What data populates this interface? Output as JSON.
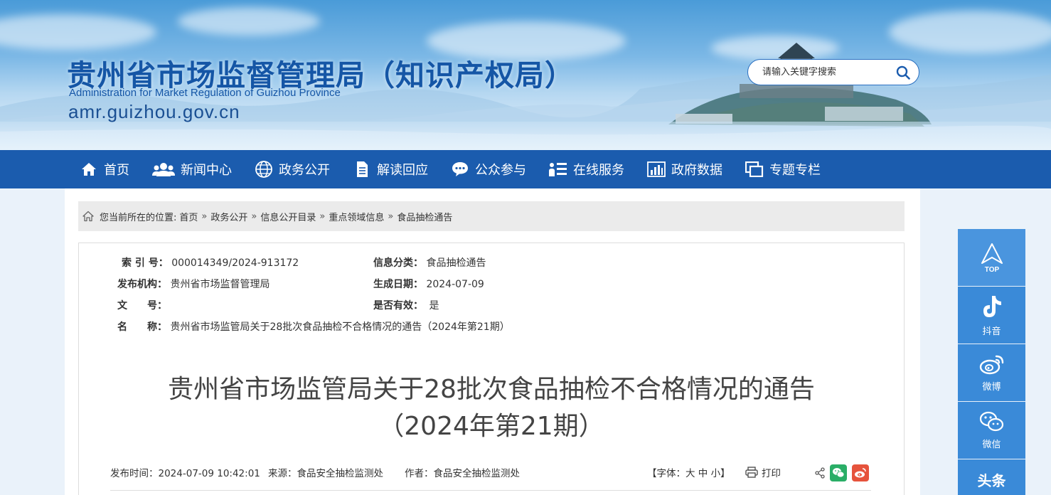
{
  "header": {
    "title": "贵州省市场监督管理局（知识产权局）",
    "subtitle_en": "Administration for Market Regulation of Guizhou Province",
    "domain": "amr.guizhou.gov.cn",
    "search_placeholder": "请输入关键字搜索",
    "search_icon": "search-icon"
  },
  "nav": {
    "items": [
      {
        "label": "首页",
        "icon": "home-icon"
      },
      {
        "label": "新闻中心",
        "icon": "users-icon"
      },
      {
        "label": "政务公开",
        "icon": "globe-icon"
      },
      {
        "label": "解读回应",
        "icon": "document-icon"
      },
      {
        "label": "公众参与",
        "icon": "chat-icon"
      },
      {
        "label": "在线服务",
        "icon": "list-icon"
      },
      {
        "label": "政府数据",
        "icon": "bar-chart-icon"
      },
      {
        "label": "专题专栏",
        "icon": "columns-icon"
      }
    ]
  },
  "breadcrumb": {
    "prefix": "您当前所在的位置:",
    "items": [
      "首页",
      "政务公开",
      "信息公开目录",
      "重点领域信息",
      "食品抽检通告"
    ],
    "separator": "»"
  },
  "meta": {
    "index_label": "索 引 号：",
    "index_value": "000014349/2024-913172",
    "category_label": "信息分类：",
    "category_value": "食品抽检通告",
    "publisher_label": "发布机构：",
    "publisher_value": "贵州省市场监督管理局",
    "date_label": "生成日期：",
    "date_value": "2024-07-09",
    "docno_label": "文　　号：",
    "docno_value": "",
    "valid_label": "是否有效：",
    "valid_value": "是",
    "name_label": "名　　称：",
    "name_value": "贵州省市场监管局关于28批次食品抽检不合格情况的通告（2024年第21期）"
  },
  "article": {
    "title_line1": "贵州省市场监管局关于28批次食品抽检不合格情况的通告",
    "title_line2": "（2024年第21期）",
    "publish_time": "发布时间：2024-07-09 10:42:01",
    "source": "来源：食品安全抽检监测处",
    "author": "作者：食品安全抽检监测处",
    "font_size_label": "【字体：大 中 小】",
    "print_label": "打印"
  },
  "float_bar": {
    "items": [
      {
        "label": "TOP",
        "icon": "top-arrow-icon"
      },
      {
        "label": "抖音",
        "icon": "douyin-icon"
      },
      {
        "label": "微博",
        "icon": "weibo-icon"
      },
      {
        "label": "微信",
        "icon": "wechat-icon"
      },
      {
        "label": "头条",
        "icon": "toutiao-icon"
      }
    ]
  },
  "colors": {
    "nav_bg": "#1b5cae",
    "title_blue": "#1556a6",
    "float_bg": "#3a8ad8",
    "wechat_green": "#2aae67",
    "weibo_red": "#e6533c"
  }
}
